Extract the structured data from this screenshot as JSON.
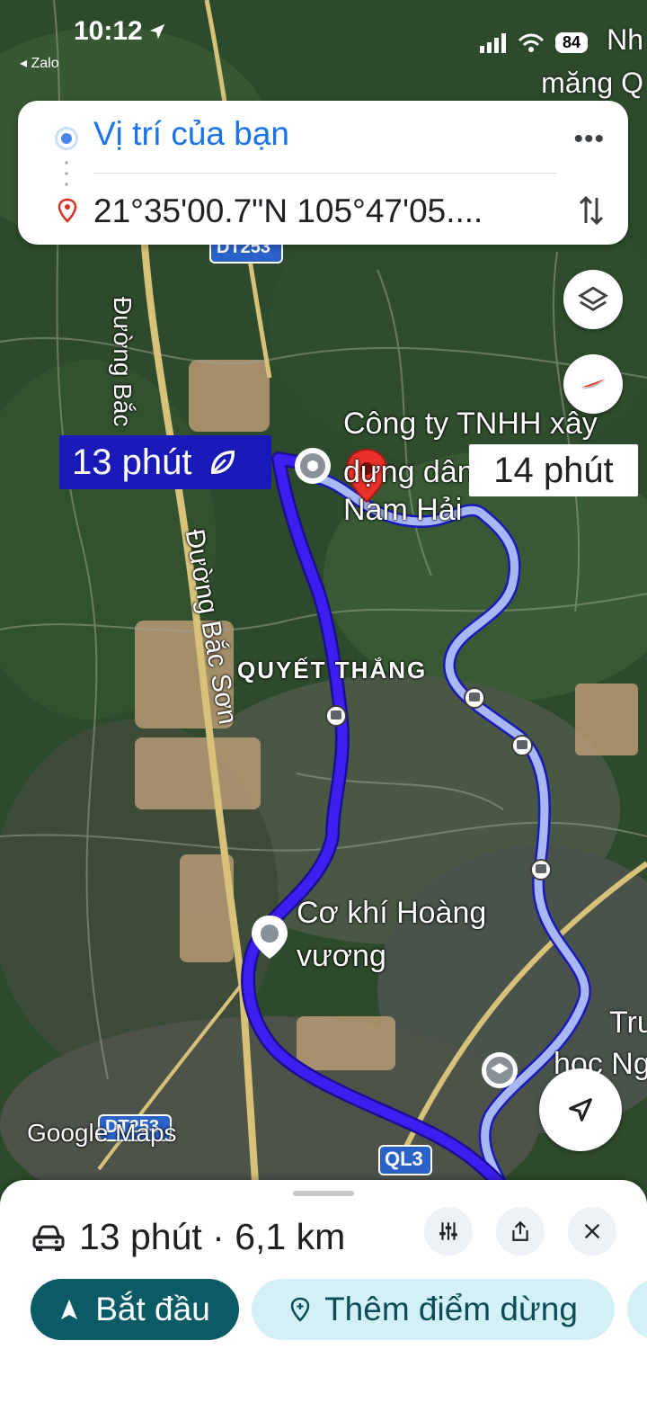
{
  "status_bar": {
    "time": "10:12",
    "back_app": "◂ Zalo",
    "battery": "84",
    "corner_text_1": "Nh",
    "corner_text_2": "măng Q"
  },
  "route_card": {
    "origin": "Vị trí của bạn",
    "destination": "21°35'00.7\"N 105°47'05...."
  },
  "map": {
    "road_labels": [
      "Đường Bắc",
      "Đường Bắc Sơn",
      "DT253",
      "DT253",
      "QL3"
    ],
    "place_labels": [
      "Công ty TNHH xây",
      "dựng dân",
      "Nam Hải",
      "QUYẾT THẮNG",
      "Cơ khí Hoàng",
      "vương",
      "Tru",
      "học Ng"
    ],
    "selected_route_time": "13 phút",
    "alt_route_time": "14 phút",
    "attribution": "Google Maps",
    "colors": {
      "selected_route": "#3d1ef0",
      "alt_route": "#a9b8f5",
      "pin": "#e8312a"
    }
  },
  "bottom_sheet": {
    "summary": "13 phút · 6,1 km",
    "start_label": "Bắt đầu",
    "add_stop_label": "Thêm điểm dừng"
  }
}
